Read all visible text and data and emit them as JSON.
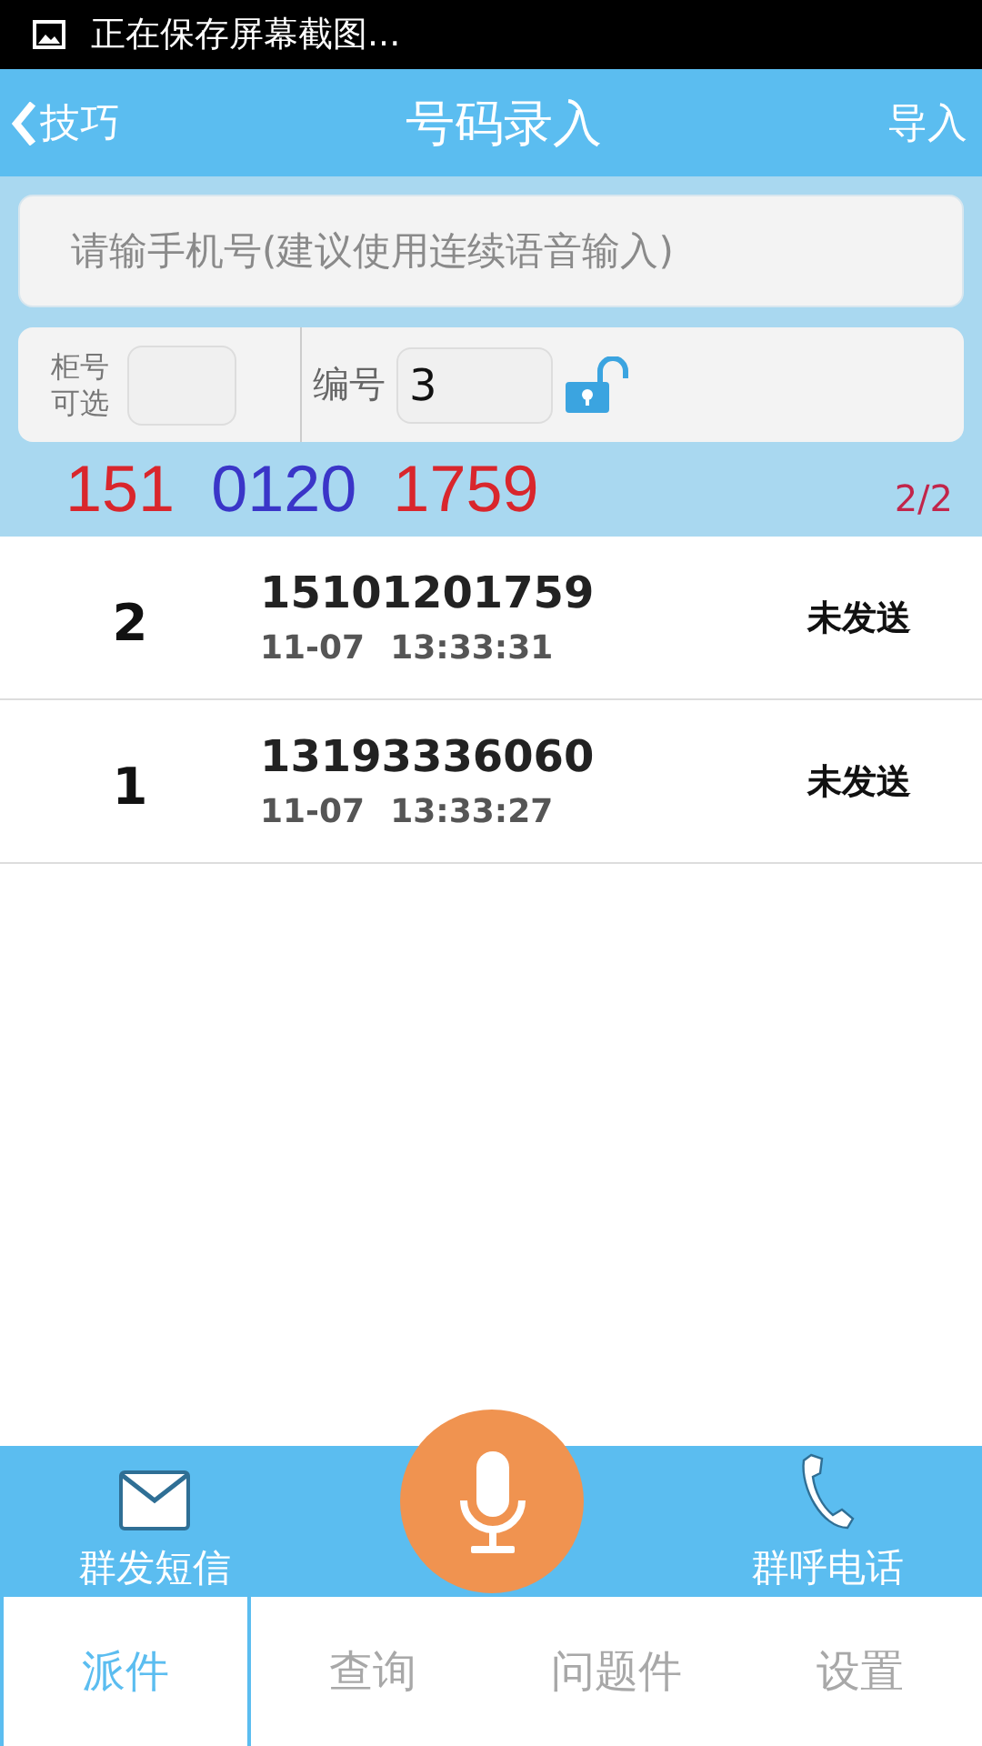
{
  "status_bar": {
    "text": "正在保存屏幕截图..."
  },
  "header": {
    "back": "技巧",
    "title": "号码录入",
    "action": "导入"
  },
  "phone_field": {
    "placeholder": "请输手机号(建议使用连续语音输入)"
  },
  "cabinet": {
    "label_lines": [
      "柜号",
      "可选"
    ]
  },
  "serial": {
    "label": "编号",
    "value": "3",
    "locked": false
  },
  "number_preview": {
    "segments": [
      {
        "text": "151",
        "color": "#d9262c"
      },
      {
        "text": "0120",
        "color": "#3a35c8"
      },
      {
        "text": "1759",
        "color": "#d9262c"
      }
    ],
    "count": "2/2"
  },
  "records": [
    {
      "index": "2",
      "phone": "15101201759",
      "date": "11-07",
      "time": "13:33:31",
      "status": "未发送"
    },
    {
      "index": "1",
      "phone": "13193336060",
      "date": "11-07",
      "time": "13:33:27",
      "status": "未发送"
    }
  ],
  "actions": {
    "sms": "群发短信",
    "call": "群呼电话"
  },
  "tabs": [
    {
      "label": "派件",
      "selected": true
    },
    {
      "label": "查询",
      "selected": false
    },
    {
      "label": "问题件",
      "selected": false
    },
    {
      "label": "设置",
      "selected": false
    }
  ]
}
